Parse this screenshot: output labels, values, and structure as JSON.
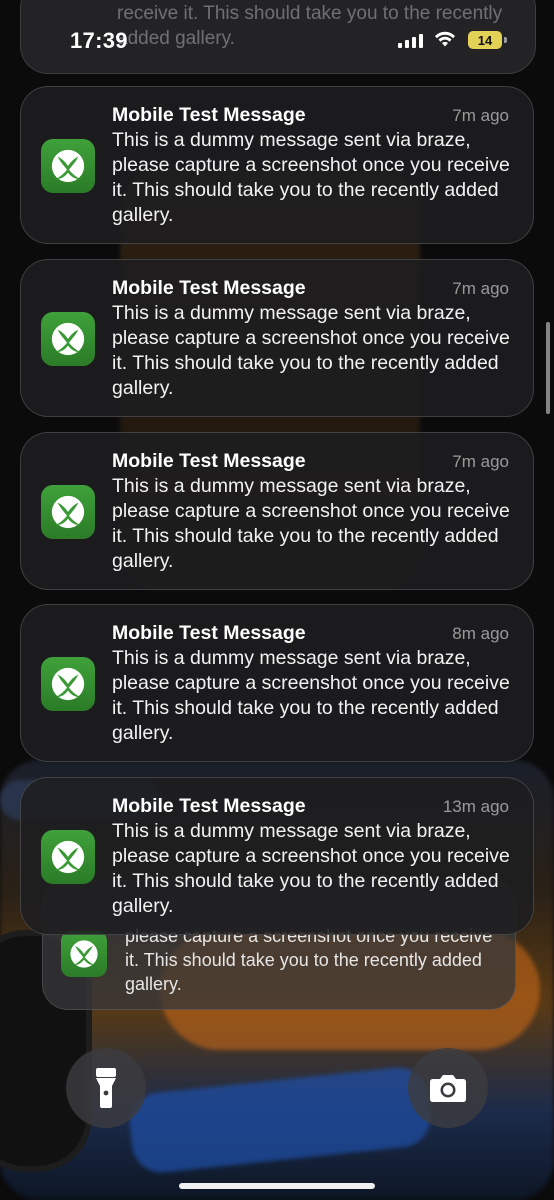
{
  "status_bar": {
    "time": "17:39",
    "battery": "14",
    "battery_color": "#e4d257"
  },
  "notifications": [
    {
      "app_icon": "xbox-icon",
      "title": "Mobile Test Message",
      "time_ago": "7m ago",
      "body": "This is a dummy message sent via braze, please capture a screenshot once you receive it. This should take you to the recently added gallery."
    },
    {
      "app_icon": "xbox-icon",
      "title": "Mobile Test Message",
      "time_ago": "7m ago",
      "body": "This is a dummy message sent via braze, please capture a screenshot once you receive it. This should take you to the recently added gallery."
    },
    {
      "app_icon": "xbox-icon",
      "title": "Mobile Test Message",
      "time_ago": "7m ago",
      "body": "This is a dummy message sent via braze, please capture a screenshot once you receive it. This should take you to the recently added gallery."
    },
    {
      "app_icon": "xbox-icon",
      "title": "Mobile Test Message",
      "time_ago": "8m ago",
      "body": "This is a dummy message sent via braze, please capture a screenshot once you receive it. This should take you to the recently added gallery."
    },
    {
      "app_icon": "xbox-icon",
      "title": "Mobile Test Message",
      "time_ago": "13m ago",
      "body": "This is a dummy message sent via braze, please capture a screenshot once you receive it. This should take you to the recently added gallery."
    }
  ],
  "partial_top_notification": {
    "body": "receive it. This should take you to the recently added gallery."
  },
  "stacked_notification": {
    "body": "please capture a screenshot once you receive it. This should take you to the recently added gallery."
  },
  "lock_controls": {
    "flashlight_icon": "flashlight-icon",
    "camera_icon": "camera-icon"
  },
  "colors": {
    "xbox_green": "#3fa13a"
  }
}
